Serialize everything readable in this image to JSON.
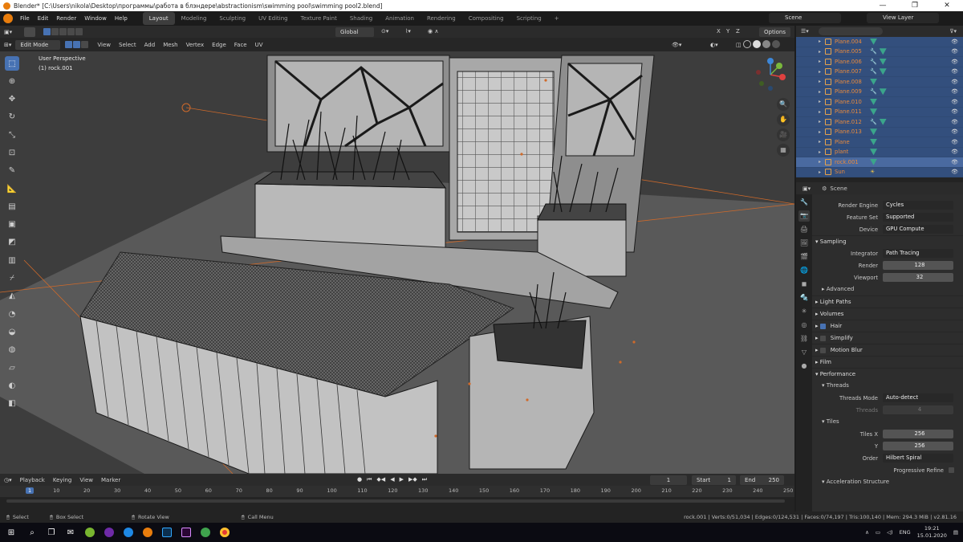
{
  "window": {
    "title": "Blender* [C:\\Users\\nikola\\Desktop\\программы\\работа в блэндере\\abstractionism\\swimming pool\\swimming pool2.blend]",
    "minimize": "—",
    "maximize": "❐",
    "close": "✕"
  },
  "topbar": {
    "menus": [
      "File",
      "Edit",
      "Render",
      "Window",
      "Help"
    ],
    "workspaces": [
      "Layout",
      "Modeling",
      "Sculpting",
      "UV Editing",
      "Texture Paint",
      "Shading",
      "Animation",
      "Rendering",
      "Compositing",
      "Scripting"
    ],
    "active_workspace": "Layout",
    "add_workspace": "+",
    "scene": "Scene",
    "view_layer": "View Layer"
  },
  "viewport_header": {
    "transform_orientation": "Global",
    "axes": [
      "X",
      "Y",
      "Z"
    ],
    "options": "Options"
  },
  "viewport_header2": {
    "mode": "Edit Mode",
    "menus": [
      "View",
      "Select",
      "Add",
      "Mesh",
      "Vertex",
      "Edge",
      "Face",
      "UV"
    ]
  },
  "viewport": {
    "perspective_label": "User Perspective",
    "object_label": "(1) rock.001",
    "background": "#3d3d3d",
    "ground": "#595959"
  },
  "toolshelf": {
    "tools": [
      "select-box",
      "cursor",
      "move",
      "rotate",
      "scale",
      "transform",
      "annotate",
      "measure",
      "extrude",
      "inset",
      "bevel",
      "loop-cut",
      "knife",
      "poly-build",
      "spin",
      "smooth",
      "shrink-fatten",
      "shear",
      "to-sphere",
      "rip"
    ],
    "active_tool": "select-box"
  },
  "gizmo": {
    "axes": [
      "X",
      "Y",
      "Z"
    ],
    "colors": {
      "x": "#e0413f",
      "y": "#7ab83c",
      "z": "#3d87d8"
    }
  },
  "outliner": {
    "rows": [
      {
        "name": "Plane.004",
        "mods": 0
      },
      {
        "name": "Plane.005",
        "mods": 1
      },
      {
        "name": "Plane.006",
        "mods": 1
      },
      {
        "name": "Plane.007",
        "mods": 1
      },
      {
        "name": "Plane.008",
        "mods": 0
      },
      {
        "name": "Plane.009",
        "mods": 1
      },
      {
        "name": "Plane.010",
        "mods": 0
      },
      {
        "name": "Plane.011",
        "mods": 0
      },
      {
        "name": "Plane.012",
        "mods": 1
      },
      {
        "name": "Plane.013",
        "mods": 0
      },
      {
        "name": "Plane",
        "mods": 0
      },
      {
        "name": "plant",
        "mods": 0
      },
      {
        "name": "rock.001",
        "mods": 0,
        "selected": true
      },
      {
        "name": "Sun",
        "mods": 0,
        "light": true
      }
    ]
  },
  "properties": {
    "context": "Scene",
    "render_engine": {
      "label": "Render Engine",
      "value": "Cycles"
    },
    "feature_set": {
      "label": "Feature Set",
      "value": "Supported"
    },
    "device": {
      "label": "Device",
      "value": "GPU Compute"
    },
    "sampling": {
      "title": "Sampling",
      "integrator": {
        "label": "Integrator",
        "value": "Path Tracing"
      },
      "render": {
        "label": "Render",
        "value": "128"
      },
      "viewport": {
        "label": "Viewport",
        "value": "32"
      },
      "advanced": "Advanced"
    },
    "light_paths": "Light Paths",
    "volumes": "Volumes",
    "hair": {
      "label": "Hair",
      "checked": true
    },
    "simplify": {
      "label": "Simplify",
      "checked": false
    },
    "motion_blur": {
      "label": "Motion Blur",
      "checked": false
    },
    "film": "Film",
    "performance": {
      "title": "Performance",
      "threads": "Threads",
      "threads_mode": {
        "label": "Threads Mode",
        "value": "Auto-detect"
      },
      "threads_count": {
        "label": "Threads",
        "value": "4"
      },
      "tiles": "Tiles",
      "tiles_x": {
        "label": "Tiles X",
        "value": "256"
      },
      "tiles_y": {
        "label": "Y",
        "value": "256"
      },
      "order": {
        "label": "Order",
        "value": "Hilbert Spiral"
      },
      "progressive_refine": {
        "label": "Progressive Refine",
        "checked": false
      },
      "acceleration": "Acceleration Structure"
    }
  },
  "timeline": {
    "menus": [
      "Playback",
      "Keying",
      "View",
      "Marker"
    ],
    "current_frame": "1",
    "start_label": "Start",
    "start": "1",
    "end_label": "End",
    "end": "250",
    "ruler": [
      "1",
      "10",
      "20",
      "30",
      "40",
      "50",
      "60",
      "70",
      "80",
      "90",
      "100",
      "110",
      "120",
      "130",
      "140",
      "150",
      "160",
      "170",
      "180",
      "190",
      "200",
      "210",
      "220",
      "230",
      "240",
      "250"
    ]
  },
  "statusbar": {
    "select": "Select",
    "box_select": "Box Select",
    "rotate_view": "Rotate View",
    "call_menu": "Call Menu",
    "stats": "rock.001 | Verts:0/51,034 | Edges:0/124,531 | Faces:0/74,197 | Tris:100,140 | Mem: 294.3 MiB | v2.81.16"
  },
  "taskbar": {
    "lang": "ENG",
    "time": "19:21",
    "date": "15.01.2020"
  }
}
